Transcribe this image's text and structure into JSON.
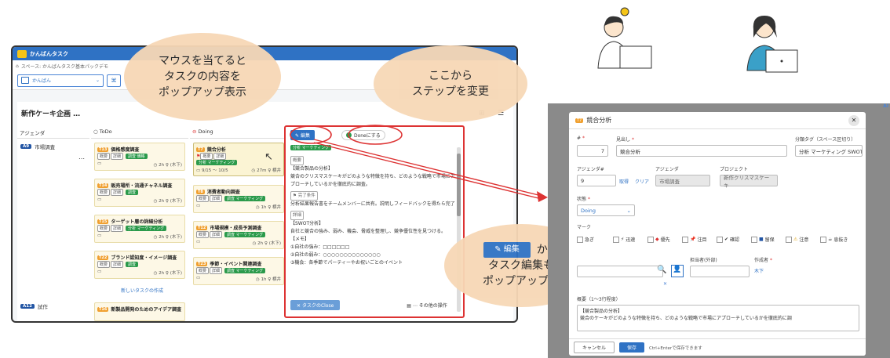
{
  "app": {
    "title": "かんばんタスク",
    "breadcrumb": "スペース: かんばんタスク基本パックデモ",
    "view_label": "かんばん",
    "project_title": "新作ケーキ企画",
    "project_more": "…"
  },
  "columns": {
    "agenda": "アジェンダ",
    "todo": "ToDo",
    "doing": "Doing"
  },
  "agendas": [
    {
      "badge": "A9",
      "label": "市場調査"
    },
    {
      "badge": "A12",
      "label": "試作"
    }
  ],
  "todo_cards": [
    {
      "no": "T13",
      "title": "価格感度調査",
      "chips": [
        "概要",
        "詳細"
      ],
      "tag": "調査 価格",
      "time": "2h",
      "who": "(木下)"
    },
    {
      "no": "T14",
      "title": "販売場所・流通チャネル調査",
      "chips": [
        "概要",
        "詳細"
      ],
      "tag": "調査",
      "time": "2h",
      "who": "(木下)"
    },
    {
      "no": "T15",
      "title": "ターゲット層の詳細分析",
      "chips": [
        "概要",
        "詳細"
      ],
      "tag": "分析 マーケティング",
      "time": "2h",
      "who": "(木下)"
    },
    {
      "no": "T22",
      "title": "ブランド認知度・イメージ調査",
      "chips": [
        "概要",
        "詳細"
      ],
      "tag": "調査",
      "time": "2h",
      "who": "(木下)"
    }
  ],
  "todo_new": "新しいタスクの作成",
  "doing_cards": [
    {
      "no": "T7",
      "title": "競合分析",
      "chips": [
        "概要",
        "詳細"
      ],
      "tag": "分析 マーケティング",
      "date": "9/15 〜 10/5",
      "time": "27m",
      "who": "横井"
    },
    {
      "no": "T8",
      "title": "消費者動向調査",
      "chips": [
        "概要",
        "詳細"
      ],
      "tag": "調査 マーケティング",
      "time": "1h",
      "who": "横井"
    },
    {
      "no": "T12",
      "title": "市場規模・成長予測調査",
      "chips": [
        "概要",
        "詳細"
      ],
      "tag": "調査 マーケティング",
      "time": "2h",
      "who": "(木下)"
    },
    {
      "no": "T23",
      "title": "季節・イベント関連調査",
      "chips": [
        "概要",
        "詳細"
      ],
      "tag": "調査 マーケティング",
      "time": "1h",
      "who": "横井"
    }
  ],
  "a12_card": {
    "no": "T16",
    "title": "新製品開発のためのアイデア調査"
  },
  "popup": {
    "edit": "編集",
    "done": "Doneにする",
    "tag": "分析 マーケティング",
    "overview_label": "概要",
    "overview_title": "【競合製品の分析】",
    "overview_text": "競合のクリスマスケーキがどのような特徴を持ち、どのような戦略で市場にアプローチしているかを徹底的に調査。",
    "done_cond_label": "完了条件",
    "done_cond_text": "分析結果報告書をチームメンバーに共有。説明しフィードバックを得たら完了",
    "detail_label": "詳細",
    "detail_title": "【SWOT分析】",
    "detail_text": "自社と競合の強み、弱み、機会、脅威を整理し、競争優位性を見つける。",
    "memo_title": "【メモ】",
    "memo1": "①自社の強み：□□□□□□",
    "memo2": "②自社の弱み：○○○○○○○○○○○○○○",
    "memo3": "③機会：各季節でパーティーやお祝いごとのイベント",
    "close": "タスクのClose",
    "other": "その他の操作"
  },
  "bubbles": {
    "hover": "マウスを当てると\nタスクの内容を\nポップアップ表示",
    "step": "ここから\nステップを変更",
    "edit_btn": "編集",
    "edit_from": "から",
    "edit_text": "タスク編集も\nポップアップで"
  },
  "dialog": {
    "no": "T7",
    "title": "競合分析",
    "num_label": "#",
    "num": "7",
    "heading_label": "見出し",
    "heading": "競合分析",
    "tag_label": "分類タグ（スペース区切り）",
    "tags": "分析 マーケティング SWOT",
    "agenda_label": "アジェンダ#",
    "agenda_num": "9",
    "get": "取得",
    "clear": "クリア",
    "agenda_col": "アジェンダ",
    "agenda_val": "市場調査",
    "project_label": "プロジェクト",
    "project_val": "新作クリスマスケーキ",
    "status_label": "状態",
    "status_val": "Doing",
    "mark_label": "マーク",
    "marks": [
      "急ぎ",
      "迅速",
      "優先",
      "注目",
      "確認",
      "留保",
      "注意",
      "息抜き"
    ],
    "owner_label": "担当者(外部)",
    "author_label": "作成者",
    "author_val": "木下",
    "overview_label": "概要（1〜3行程度）",
    "overview_title": "【競合製品の分析】",
    "overview_text": "競合のケーキがどのような特徴を持ち、どのような戦略で市場にアプローチしているかを徹底的に調",
    "cancel": "キャンセル",
    "save": "保存",
    "hint": "Ctrl+Enterで保存できます"
  },
  "colors": {
    "accent": "#2f72c4",
    "tag_green": "#2b9a4b",
    "card_bg": "#fdf8e6",
    "bubble": "#f7d8b6",
    "highlight": "#dd3333"
  }
}
